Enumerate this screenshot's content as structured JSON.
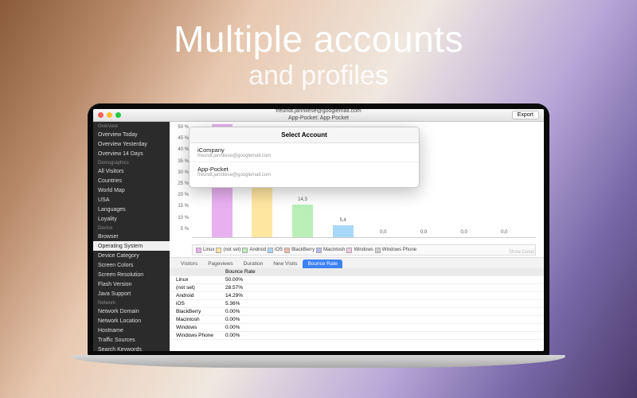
{
  "hero": {
    "line1": "Multiple accounts",
    "line2": "and profiles"
  },
  "window": {
    "title_line1": "freundt.jannliese@googlemail.com",
    "title_line2": "App-Pocket: App-Pocket",
    "export": "Export"
  },
  "sidebar": {
    "groups": [
      {
        "header": "Overview",
        "items": [
          "Overview Today",
          "Overview Yesterday",
          "Overview 14 Days"
        ]
      },
      {
        "header": "Demographics",
        "items": [
          "All Visitors",
          "Countries",
          "World Map",
          "USA",
          "Languages",
          "Loyality"
        ]
      },
      {
        "header": "Device",
        "items": [
          "Browser",
          "Operating System",
          "Device Category",
          "Screen Colors",
          "Screen Resolution",
          "Flash Version",
          "Java Support"
        ]
      },
      {
        "header": "Network",
        "items": [
          "Network Domain",
          "Network Location",
          "Hostname",
          "Traffic Sources",
          "Search Keywords"
        ]
      }
    ],
    "selected": "Operating System"
  },
  "chart_data": {
    "type": "bar",
    "title": "",
    "xlabel": "",
    "ylabel": "",
    "ylim": [
      0,
      50
    ],
    "yticks": [
      "50 %",
      "45 %",
      "40 %",
      "35 %",
      "30 %",
      "25 %",
      "20 %",
      "15 %",
      "10 %",
      "5 %"
    ],
    "categories": [
      "Linux",
      "(not set)",
      "Android",
      "iOS",
      "BlackBerry",
      "Macintosh",
      "Windows",
      "Windows Phone"
    ],
    "values": [
      50.0,
      28.57,
      14.3,
      5.4,
      0.0,
      0.0,
      0.0,
      0.0
    ],
    "labels": [
      "",
      "",
      "14,3",
      "5,4",
      "0,0",
      "0,0",
      "0,0",
      "0,0"
    ],
    "colors": [
      "#e8b0f0",
      "#ffe6a0",
      "#b8f0b8",
      "#a8d8f8",
      "#f0b8a8",
      "#b8b8f0",
      "#f8c8e0",
      "#d0d0d0"
    ]
  },
  "tabs": {
    "items": [
      "Visitors",
      "Pageviews",
      "Duration",
      "New Visits",
      "Bounce Rate"
    ],
    "active": 4
  },
  "table": {
    "header": [
      "",
      "Bounce Rate"
    ],
    "rows": [
      [
        "Linux",
        "50.00%"
      ],
      [
        "(not set)",
        "28.57%"
      ],
      [
        "Android",
        "14.29%"
      ],
      [
        "iOS",
        "5.36%"
      ],
      [
        "BlackBerry",
        "0.00%"
      ],
      [
        "Macintosh",
        "0.00%"
      ],
      [
        "Windows",
        "0.00%"
      ],
      [
        "Windows Phone",
        "0.00%"
      ]
    ]
  },
  "popup": {
    "title": "Select Account",
    "accounts": [
      {
        "name": "iCompany",
        "email": "freundt.jannliese@googlemail.com"
      },
      {
        "name": "App-Pocket",
        "email": "freundt.jannliese@googlemail.com"
      }
    ]
  },
  "show_detail": "Show Detail"
}
